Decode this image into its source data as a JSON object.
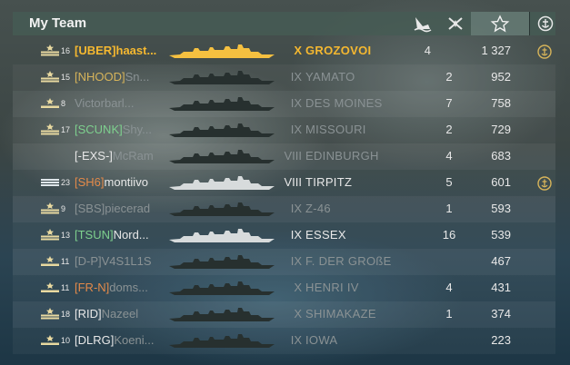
{
  "header": {
    "team_title": "My Team",
    "icons": [
      "ship-sunk-icon",
      "planes-destroyed-icon",
      "score-star-icon",
      "achievement-badge-icon"
    ]
  },
  "colors": {
    "self": "#f5b830",
    "alive": "#e8e8e8",
    "dead": "#8a9294",
    "clan_green": "#7ed08e",
    "clan_orange": "#e38a4a",
    "clan_gold": "#d7b45a"
  },
  "players": [
    {
      "level": "16",
      "clan": "[UBER]",
      "name": "haast...",
      "tier": "X",
      "ship": "GROZOVOI",
      "kills": "4",
      "planes": "",
      "score": "1 327",
      "rank_icon": "rank-two-stripes-star-icon",
      "badge": true,
      "state": "self",
      "clan_color": "self"
    },
    {
      "level": "15",
      "clan": "[NHOOD]",
      "name": "Sn...",
      "tier": "IX",
      "ship": "YAMATO",
      "kills": "",
      "planes": "2",
      "score": "952",
      "rank_icon": "rank-two-stripes-star-icon",
      "badge": false,
      "state": "dead",
      "clan_color": "gold"
    },
    {
      "level": "8",
      "clan": "",
      "name": "Victorbarl...",
      "tier": "IX",
      "ship": "DES MOINES",
      "kills": "",
      "planes": "7",
      "score": "758",
      "rank_icon": "rank-one-stripe-icon",
      "badge": false,
      "state": "dead",
      "clan_color": "grey"
    },
    {
      "level": "17",
      "clan": "[SCUNK]",
      "name": "Shy...",
      "tier": "IX",
      "ship": "MISSOURI",
      "kills": "",
      "planes": "2",
      "score": "729",
      "rank_icon": "rank-two-stripes-star-icon",
      "badge": false,
      "state": "dead",
      "clan_color": "green"
    },
    {
      "level": "",
      "clan": "[-EXS-]",
      "name": "McRam",
      "tier": "VIII",
      "ship": "EDINBURGH",
      "kills": "",
      "planes": "4",
      "score": "683",
      "rank_icon": "",
      "badge": false,
      "state": "dead",
      "clan_color": "white"
    },
    {
      "level": "23",
      "clan": "[SH6]",
      "name": "montiivo",
      "tier": "VIII",
      "ship": "TIRPITZ",
      "kills": "",
      "planes": "5",
      "score": "601",
      "rank_icon": "rank-flat-bar-icon",
      "badge": true,
      "state": "alive",
      "clan_color": "orange"
    },
    {
      "level": "9",
      "clan": "[SBS]",
      "name": "piecerad",
      "tier": "IX",
      "ship": "Z-46",
      "kills": "",
      "planes": "1",
      "score": "593",
      "rank_icon": "rank-two-stripes-star-icon",
      "badge": false,
      "state": "dead",
      "clan_color": "grey"
    },
    {
      "level": "13",
      "clan": "[TSUN]",
      "name": "Nord...",
      "tier": "IX",
      "ship": "ESSEX",
      "kills": "",
      "planes": "16",
      "score": "539",
      "rank_icon": "rank-two-stripes-star-icon",
      "badge": false,
      "state": "alive",
      "clan_color": "green"
    },
    {
      "level": "11",
      "clan": "[D-P]",
      "name": "V4S1L1S",
      "tier": "IX",
      "ship": "F. DER GROßE",
      "kills": "",
      "planes": "",
      "score": "467",
      "rank_icon": "rank-one-stripe-icon",
      "badge": false,
      "state": "dead",
      "clan_color": "grey"
    },
    {
      "level": "11",
      "clan": "[FR-N]",
      "name": "doms...",
      "tier": "X",
      "ship": "HENRI IV",
      "kills": "",
      "planes": "4",
      "score": "431",
      "rank_icon": "rank-one-stripe-icon",
      "badge": false,
      "state": "dead",
      "clan_color": "orange"
    },
    {
      "level": "18",
      "clan": "[RID]",
      "name": "Nazeel",
      "tier": "X",
      "ship": "SHIMAKAZE",
      "kills": "",
      "planes": "1",
      "score": "374",
      "rank_icon": "rank-two-stripes-star-icon",
      "badge": false,
      "state": "dead",
      "clan_color": "white"
    },
    {
      "level": "10",
      "clan": "[DLRG]",
      "name": "Koeni...",
      "tier": "IX",
      "ship": "IOWA",
      "kills": "",
      "planes": "",
      "score": "223",
      "rank_icon": "rank-one-stripe-icon",
      "badge": false,
      "state": "dead",
      "clan_color": "white"
    }
  ]
}
